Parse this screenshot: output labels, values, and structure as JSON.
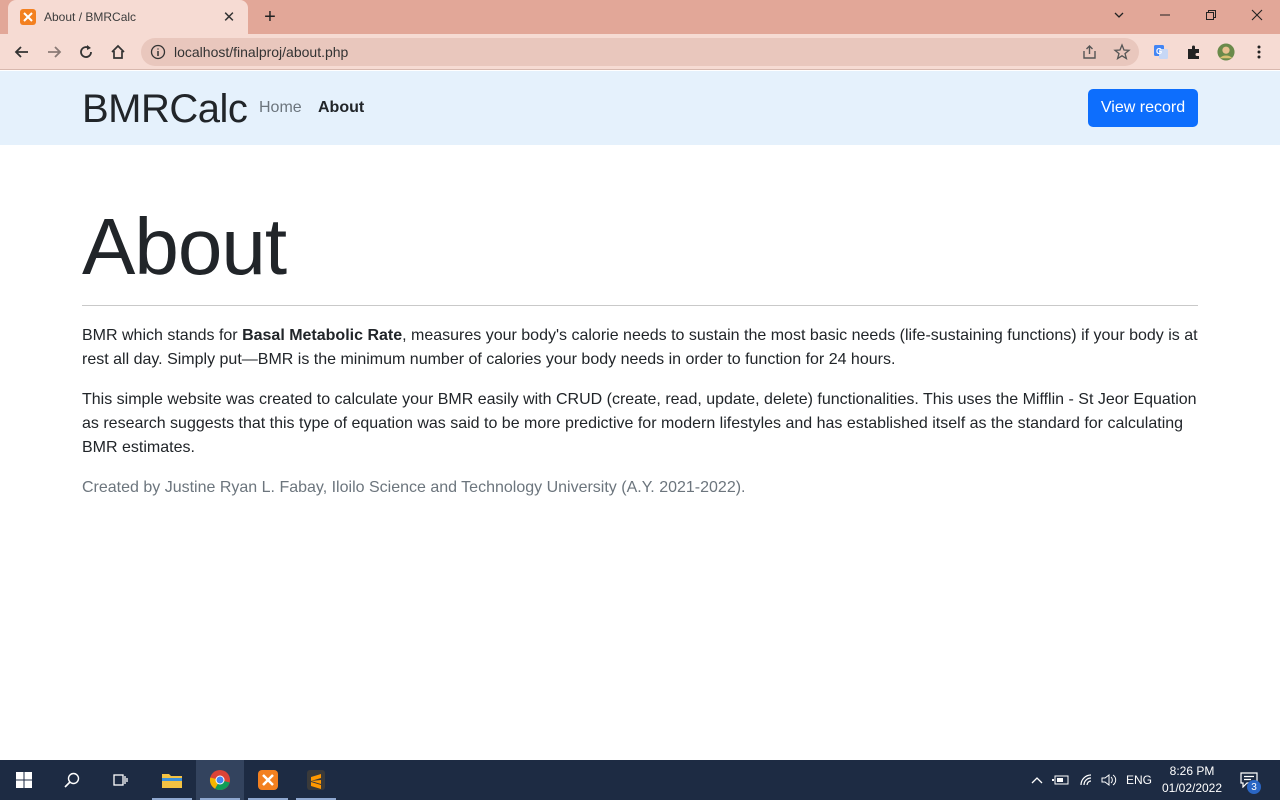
{
  "browser": {
    "tab_title": "About / BMRCalc",
    "url": "localhost/finalproj/about.php"
  },
  "navbar": {
    "brand_bold": "BMR",
    "brand_light": "Calc",
    "home_label": "Home",
    "about_label": "About",
    "view_record_label": "View record"
  },
  "main": {
    "title": "About",
    "para1_prefix": "BMR which stands for ",
    "para1_bold": "Basal Metabolic Rate",
    "para1_suffix": ", measures your body's calorie needs to sustain the most basic needs (life-sustaining functions) if your body is at rest all day. Simply put—BMR is the minimum number of calories your body needs in order to function for 24 hours.",
    "para2": "This simple website was created to calculate your BMR easily with CRUD (create, read, update, delete) functionalities. This uses the Mifflin - St Jeor Equation as research suggests that this type of equation was said to be more predictive for modern lifestyles and has established itself as the standard for calculating BMR estimates.",
    "credit": "Created by Justine Ryan L. Fabay, Iloilo Science and Technology University (A.Y. 2021-2022)."
  },
  "taskbar": {
    "language": "ENG",
    "time": "8:26 PM",
    "date": "01/02/2022",
    "notification_count": "3"
  },
  "icons": {
    "tab_favicon": "xampp-icon",
    "back": "back-arrow-icon",
    "forward": "forward-arrow-icon",
    "reload": "reload-icon",
    "home": "home-icon",
    "site_info": "info-icon",
    "share": "share-icon",
    "bookmark": "star-icon",
    "translate": "google-translate-icon",
    "extensions": "puzzle-icon",
    "profile": "avatar",
    "menu": "kebab-menu-icon"
  },
  "colors": {
    "primary_button": "#0d6efd",
    "navbar_bg": "#e5f1fc",
    "browser_frame": "#e2a798",
    "taskbar_bg": "#1d2b43"
  }
}
